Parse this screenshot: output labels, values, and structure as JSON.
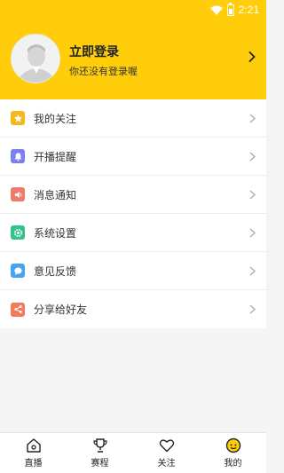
{
  "status_bar": {
    "time": "2:21",
    "icons": [
      "wifi-icon",
      "battery-icon"
    ]
  },
  "profile": {
    "title": "立即登录",
    "subtitle": "你还没有登录喔",
    "avatar_icon": "avatar-placeholder-icon",
    "header_color": "#ffcd0a"
  },
  "menu": {
    "items": [
      {
        "label": "我的关注",
        "icon": "star-icon",
        "color": "#f5b81c"
      },
      {
        "label": "开播提醒",
        "icon": "bell-icon",
        "color": "#7b7ff0"
      },
      {
        "label": "消息通知",
        "icon": "speaker-icon",
        "color": "#f07b6a"
      },
      {
        "label": "系统设置",
        "icon": "gear-icon",
        "color": "#33c38a"
      },
      {
        "label": "意见反馈",
        "icon": "chat-bubble-icon",
        "color": "#4aa3f0"
      },
      {
        "label": "分享给好友",
        "icon": "share-icon",
        "color": "#f47a5c"
      }
    ]
  },
  "tabbar": {
    "tabs": [
      {
        "label": "直播",
        "icon": "home-icon"
      },
      {
        "label": "赛程",
        "icon": "trophy-icon"
      },
      {
        "label": "关注",
        "icon": "heart-icon"
      },
      {
        "label": "我的",
        "icon": "profile-face-icon",
        "active": true
      }
    ]
  }
}
